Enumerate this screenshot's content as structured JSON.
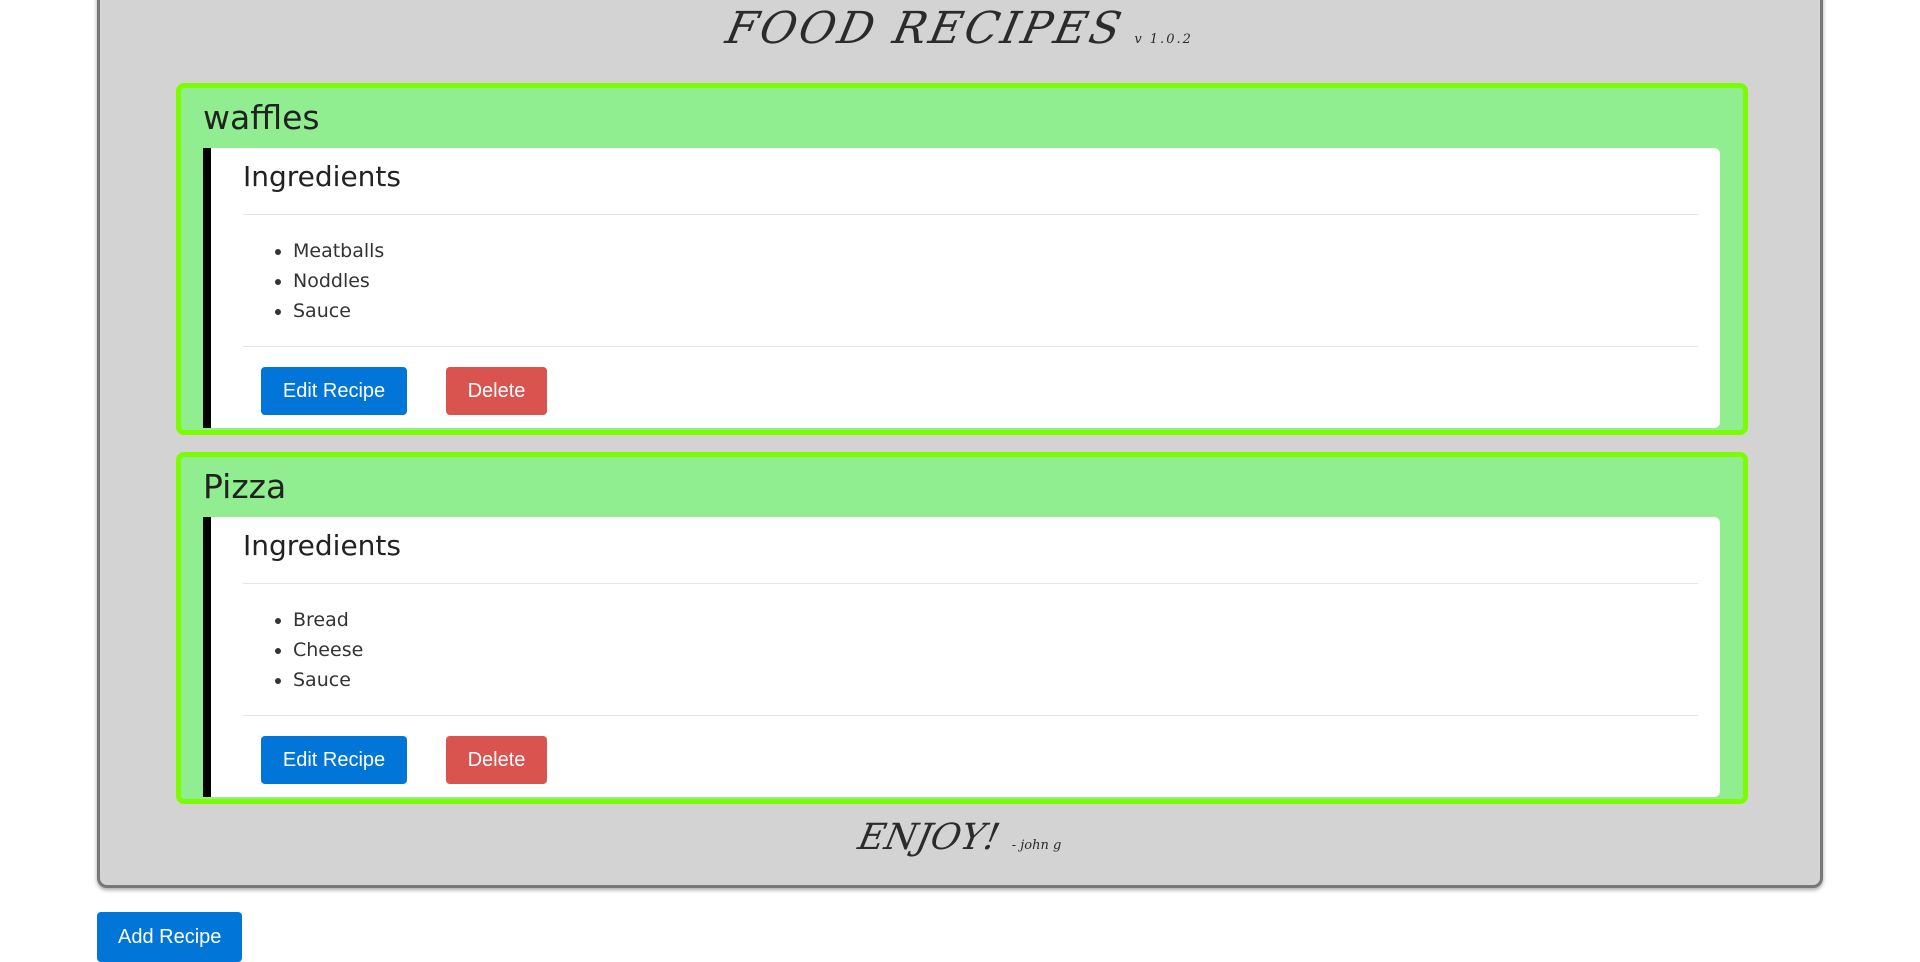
{
  "app": {
    "title": "FOOD RECIPES",
    "version": "v 1.0.2",
    "footer": "ENJOY!",
    "footer_signature": "- john g"
  },
  "recipes": [
    {
      "name": "waffles",
      "ingredients_heading": "Ingredients",
      "ingredients": [
        "Meatballs",
        "Noddles",
        "Sauce"
      ],
      "edit_label": "Edit Recipe",
      "delete_label": "Delete"
    },
    {
      "name": "Pizza",
      "ingredients_heading": "Ingredients",
      "ingredients": [
        "Bread",
        "Cheese",
        "Sauce"
      ],
      "edit_label": "Edit Recipe",
      "delete_label": "Delete"
    }
  ],
  "add_recipe_label": "Add Recipe",
  "colors": {
    "panel": "#d3d3d3",
    "card": "#90ee90",
    "card_border": "#7cfc00",
    "primary": "#0275d8",
    "danger": "#d9534f"
  }
}
